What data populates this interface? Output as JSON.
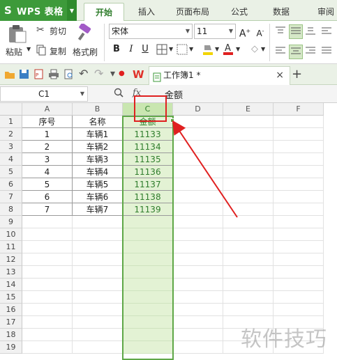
{
  "app": {
    "name": "WPS 表格",
    "logo": "S"
  },
  "menu": {
    "tabs": [
      "开始",
      "插入",
      "页面布局",
      "公式",
      "数据",
      "审阅"
    ],
    "active": "开始"
  },
  "ribbon": {
    "paste_label": "粘贴",
    "cut_label": "剪切",
    "copy_label": "复制",
    "format_painter_label": "格式刷",
    "font_name": "宋体",
    "font_size": "11",
    "bold": "B",
    "italic": "I",
    "underline": "U"
  },
  "document": {
    "tab_title": "工作簿1 *"
  },
  "formula_bar": {
    "cell_ref": "C1",
    "fx": "fx",
    "content": "金额"
  },
  "sheet": {
    "columns": [
      "A",
      "B",
      "C",
      "D",
      "E",
      "F"
    ],
    "rows": [
      "1",
      "2",
      "3",
      "4",
      "5",
      "6",
      "7",
      "8",
      "9",
      "10",
      "11",
      "12",
      "13",
      "14",
      "15",
      "16",
      "17",
      "18",
      "19"
    ],
    "headers": [
      "序号",
      "名称",
      "金额"
    ],
    "data": [
      [
        "1",
        "车辆1",
        "11133"
      ],
      [
        "2",
        "车辆2",
        "11134"
      ],
      [
        "3",
        "车辆3",
        "11135"
      ],
      [
        "4",
        "车辆4",
        "11136"
      ],
      [
        "5",
        "车辆5",
        "11137"
      ],
      [
        "6",
        "车辆6",
        "11138"
      ],
      [
        "7",
        "车辆7",
        "11139"
      ]
    ],
    "selected_column": "C"
  },
  "watermark": "软件技巧",
  "colors": {
    "brand": "#3d9a3a",
    "selection": "#5ea747",
    "annotation": "#e02020"
  }
}
